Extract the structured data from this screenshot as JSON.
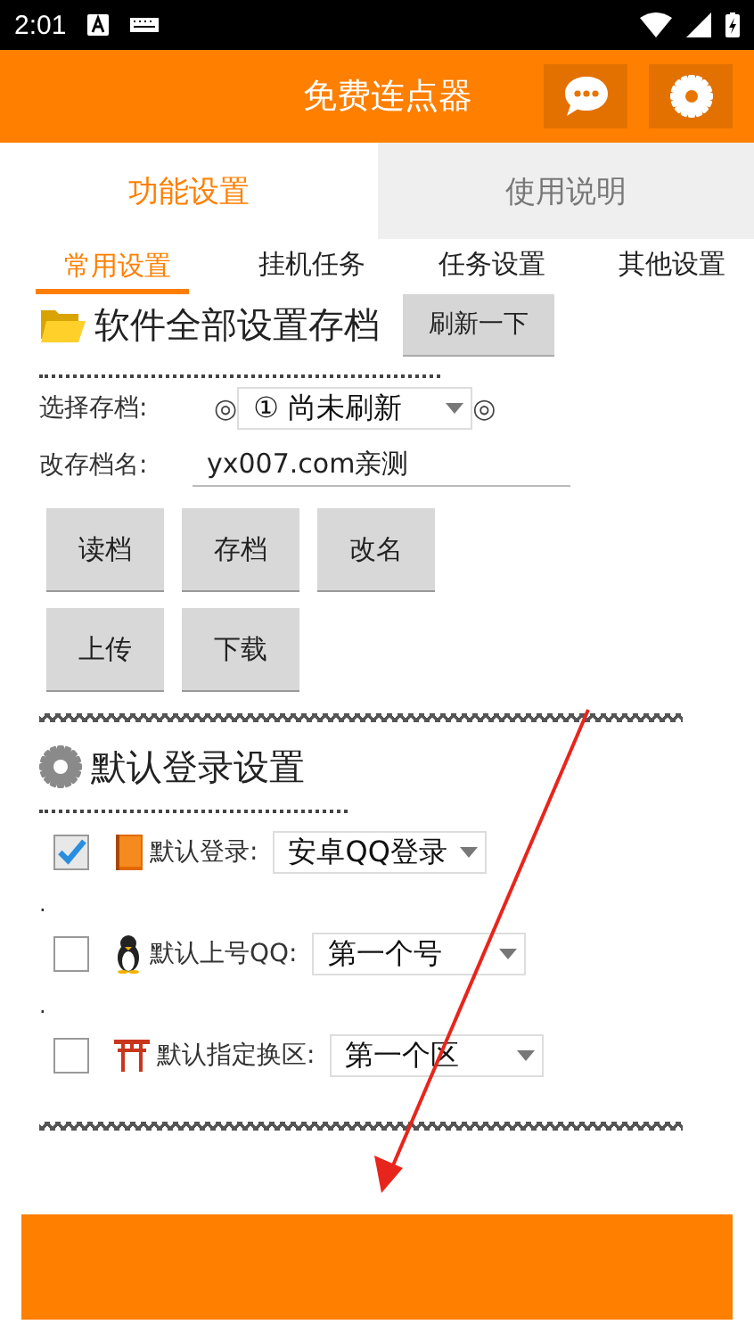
{
  "status_bar": {
    "time": "2:01"
  },
  "app_bar": {
    "title": "免费连点器"
  },
  "tabs": [
    {
      "label": "功能设置",
      "selected": true
    },
    {
      "label": "使用说明",
      "selected": false
    }
  ],
  "subtabs": [
    {
      "label": "常用设置",
      "selected": true
    },
    {
      "label": "挂机任务",
      "selected": false
    },
    {
      "label": "任务设置",
      "selected": false
    },
    {
      "label": "其他设置",
      "selected": false
    }
  ],
  "archive_section": {
    "title": "软件全部设置存档",
    "refresh_button": "刷新一下",
    "select_label": "选择存档:",
    "select_mark_left": "◎",
    "select_value": "① 尚未刷新",
    "select_mark_right": "◎",
    "rename_label": "改存档名:",
    "rename_value": "yx007.com亲测",
    "button_rows": [
      [
        "读档",
        "存档",
        "改名"
      ],
      [
        "上传",
        "下载"
      ]
    ]
  },
  "login_section": {
    "title": "默认登录设置",
    "options": [
      {
        "label": "默认登录:",
        "value": "安卓QQ登录",
        "checked": true
      },
      {
        "prefix": ".",
        "label": "默认上号QQ:",
        "value": "第一个号",
        "checked": false
      },
      {
        "prefix": ".",
        "label": "默认指定换区:",
        "value": "第一个区",
        "checked": false
      }
    ]
  }
}
